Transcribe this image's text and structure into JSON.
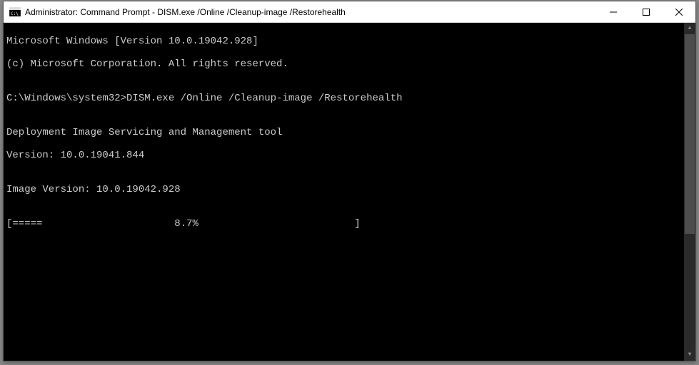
{
  "titlebar": {
    "text": "Administrator: Command Prompt - DISM.exe  /Online /Cleanup-image /Restorehealth"
  },
  "terminal": {
    "line1": "Microsoft Windows [Version 10.0.19042.928]",
    "line2": "(c) Microsoft Corporation. All rights reserved.",
    "blank1": "",
    "prompt_line": "C:\\Windows\\system32>DISM.exe /Online /Cleanup-image /Restorehealth",
    "blank2": "",
    "dism1": "Deployment Image Servicing and Management tool",
    "dism2": "Version: 10.0.19041.844",
    "blank3": "",
    "image_version": "Image Version: 10.0.19042.928",
    "blank4": "",
    "progress": "[=====                      8.7%                          ] "
  }
}
